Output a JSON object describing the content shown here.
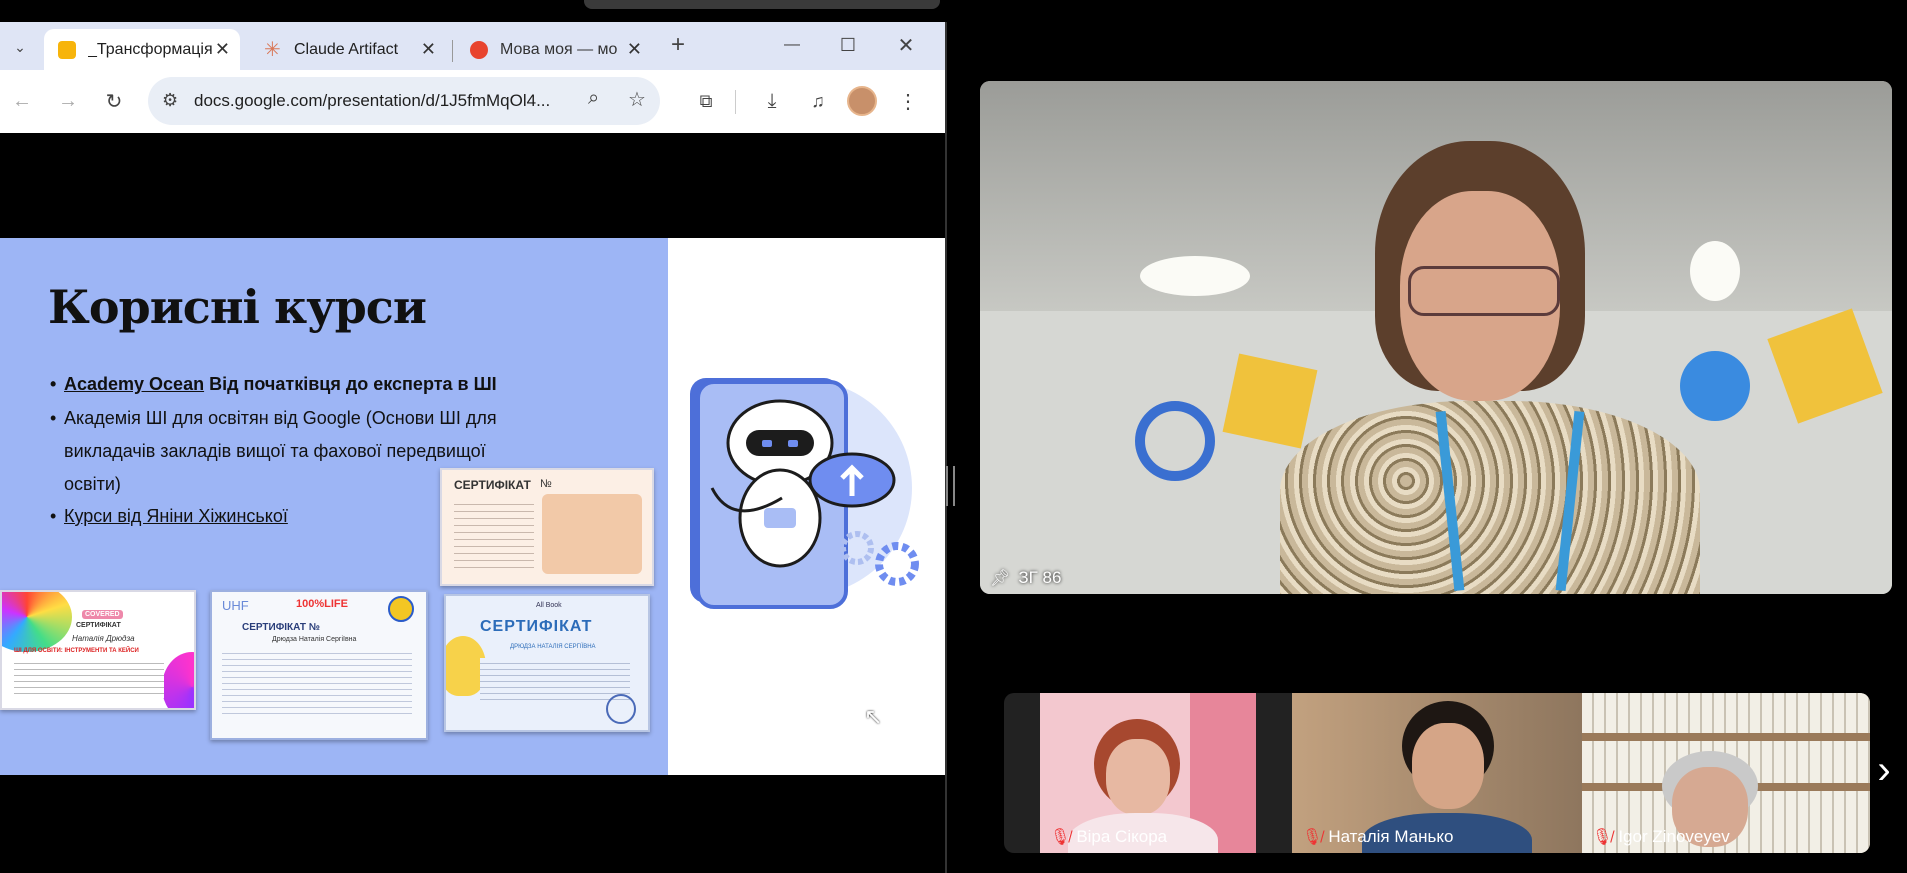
{
  "browser": {
    "tabs": [
      {
        "label": "_Трансформація",
        "active": true,
        "favicon_color": "#f7b40b"
      },
      {
        "label": "Claude Artifact",
        "active": false,
        "favicon_color": "#d97757"
      },
      {
        "label": "Мова моя — мо",
        "active": false,
        "favicon_color": "#e8442e"
      }
    ],
    "new_tab": "+",
    "window_controls": {
      "minimize": "—",
      "maximize": "☐",
      "close": "✕"
    },
    "url": "docs.google.com/presentation/d/1J5fmMqOl4..."
  },
  "slide": {
    "title": "Корисні курси",
    "bullets": [
      {
        "link": "Academy Ocean",
        "text": " Від початківця до експерта в ШІ"
      },
      {
        "line1": "Академія ШІ для освітян від Google (Основи ШІ для",
        "line2": "викладачів закладів вищої та фахової передвищої",
        "line3": "освіти)"
      },
      {
        "link": "Курси від Яніни Хіжинської"
      }
    ],
    "certificates": {
      "google": "СЕРТИФІКАТ",
      "google_no": "№",
      "uhf_brand": "UHF",
      "uhf_life": "100%LIFE",
      "uhf_title": "СЕРТИФІКАТ №",
      "uhf_name": "Дрюдза Наталія Сергіївна",
      "allbook_title": "СЕРТИФІКАТ",
      "allbook_brand": "All Book",
      "allbook_name": "ДРЮДЗА НАТАЛІЯ СЕРГІЇВНА",
      "left_brand": "COVERED",
      "left_title": "СЕРТИФІКАТ",
      "left_name": "Наталія Дрюдза",
      "left_course": "ШІ ДЛЯ ОСВІТИ: ІНСТРУМЕНТИ ТА КЕЙСИ"
    }
  },
  "video": {
    "main_label": "ЗГ 86",
    "participants": [
      {
        "name": "Віра Сікора"
      },
      {
        "name": "Наталія Манько"
      },
      {
        "name": "Igor Zinoveyev"
      }
    ],
    "next_arrow": "›"
  }
}
